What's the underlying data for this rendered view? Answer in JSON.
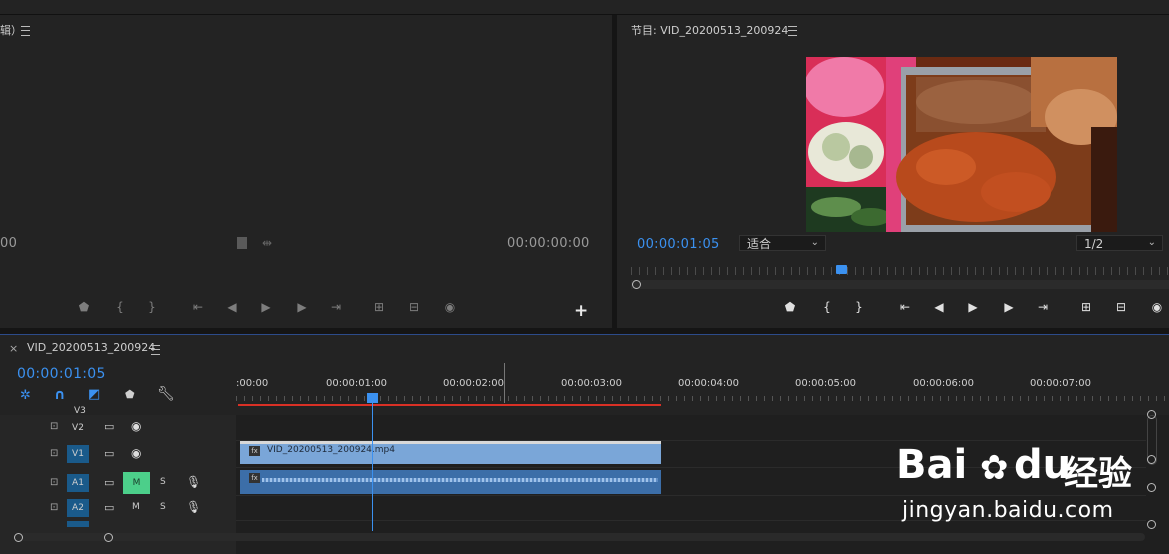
{
  "source_panel": {
    "title_fragment": "辑）",
    "timecode_left": "00",
    "timecode_right": "00:00:00:00"
  },
  "program_panel": {
    "title": "节目: VID_20200513_200924",
    "timecode": "00:00:01:05",
    "fit_dropdown": "适合",
    "resolution_dropdown": "1/2"
  },
  "timeline": {
    "sequence_name": "VID_20200513_200924",
    "playhead_timecode": "00:00:01:05",
    "ruler_labels": [
      ":00:00",
      "00:00:01:00",
      "00:00:02:00",
      "00:00:03:00",
      "00:00:04:00",
      "00:00:05:00",
      "00:00:06:00",
      "00:00:07:00"
    ],
    "tracks": {
      "v3": "V3",
      "v2": "V2",
      "v1": "V1",
      "a1": "A1",
      "a2": "A2"
    },
    "mute_label": "M",
    "solo_label": "S",
    "clip_video_name": "VID_20200513_200924.mp4",
    "fx_badge": "fx"
  },
  "watermark": {
    "brand_latin": "Bai",
    "brand_du": "du",
    "brand_cn": "经验",
    "url": "jingyan.baidu.com"
  },
  "colors": {
    "accent_blue": "#3b91f0",
    "clip_video": "#7aa6d8",
    "clip_audio": "#3c6ea8",
    "mute_green": "#4ccf8a",
    "work_area_red": "#d93025"
  }
}
